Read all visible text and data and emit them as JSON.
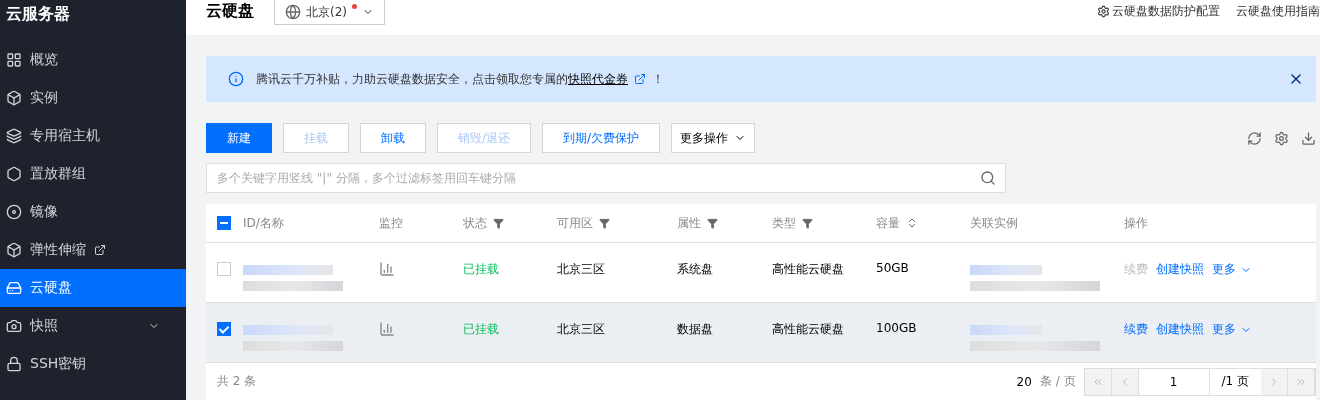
{
  "sidebar": {
    "title": "云服务器",
    "items": [
      {
        "label": "概览",
        "selected": false,
        "external": false,
        "expandable": false
      },
      {
        "label": "实例",
        "selected": false,
        "external": false,
        "expandable": false
      },
      {
        "label": "专用宿主机",
        "selected": false,
        "external": false,
        "expandable": false
      },
      {
        "label": "置放群组",
        "selected": false,
        "external": false,
        "expandable": false
      },
      {
        "label": "镜像",
        "selected": false,
        "external": false,
        "expandable": false
      },
      {
        "label": "弹性伸缩",
        "selected": false,
        "external": true,
        "expandable": false
      },
      {
        "label": "云硬盘",
        "selected": true,
        "external": false,
        "expandable": false
      },
      {
        "label": "快照",
        "selected": false,
        "external": false,
        "expandable": true
      },
      {
        "label": "SSH密钥",
        "selected": false,
        "external": false,
        "expandable": false
      }
    ]
  },
  "header": {
    "title": "云硬盘",
    "region": {
      "label": "北京(2)",
      "alert": true
    },
    "links": [
      "云硬盘数据防护配置",
      "云硬盘使用指南"
    ]
  },
  "banner": {
    "before": "腾讯云千万补贴，力助云硬盘数据安全，点击领取您专属的",
    "link": "快照代金券",
    "after": "！"
  },
  "toolbar": {
    "buttons": [
      {
        "label": "新建",
        "kind": "primary",
        "disabled": false
      },
      {
        "label": "挂载",
        "kind": "default",
        "disabled": true
      },
      {
        "label": "卸载",
        "kind": "default",
        "disabled": false
      },
      {
        "label": "销毁/退还",
        "kind": "default",
        "disabled": true
      },
      {
        "label": "到期/欠费保护",
        "kind": "default",
        "disabled": false
      },
      {
        "label": "更多操作",
        "kind": "dropdown",
        "disabled": false
      }
    ]
  },
  "search": {
    "placeholder": "多个关键字用竖线 \"|\" 分隔，多个过滤标签用回车键分隔"
  },
  "table": {
    "select_all": {
      "indeterminate": true
    },
    "columns": [
      {
        "label": "ID/名称",
        "kind": "plain"
      },
      {
        "label": "监控",
        "kind": "plain"
      },
      {
        "label": "状态",
        "kind": "filter"
      },
      {
        "label": "可用区",
        "kind": "filter"
      },
      {
        "label": "属性",
        "kind": "filter"
      },
      {
        "label": "类型",
        "kind": "filter"
      },
      {
        "label": "容量",
        "kind": "sort"
      },
      {
        "label": "关联实例",
        "kind": "plain"
      },
      {
        "label": "操作",
        "kind": "plain"
      }
    ],
    "rows": [
      {
        "selected": false,
        "status": {
          "label": "已挂载",
          "kind": "attached"
        },
        "zone": "北京三区",
        "attribute": "系统盘",
        "type": "高性能云硬盘",
        "capacity": "50GB",
        "actions": [
          {
            "label": "续费",
            "disabled": true
          },
          {
            "label": "创建快照",
            "disabled": false
          }
        ],
        "more": "更多"
      },
      {
        "selected": true,
        "status": {
          "label": "已挂载",
          "kind": "attached"
        },
        "zone": "北京三区",
        "attribute": "数据盘",
        "type": "高性能云硬盘",
        "capacity": "100GB",
        "actions": [
          {
            "label": "续费",
            "disabled": false
          },
          {
            "label": "创建快照",
            "disabled": false
          }
        ],
        "more": "更多"
      }
    ]
  },
  "footer": {
    "total": "共 2 条",
    "page_size": "20",
    "per_page": "条 / 页",
    "page": "1",
    "pages": "/1 页"
  }
}
